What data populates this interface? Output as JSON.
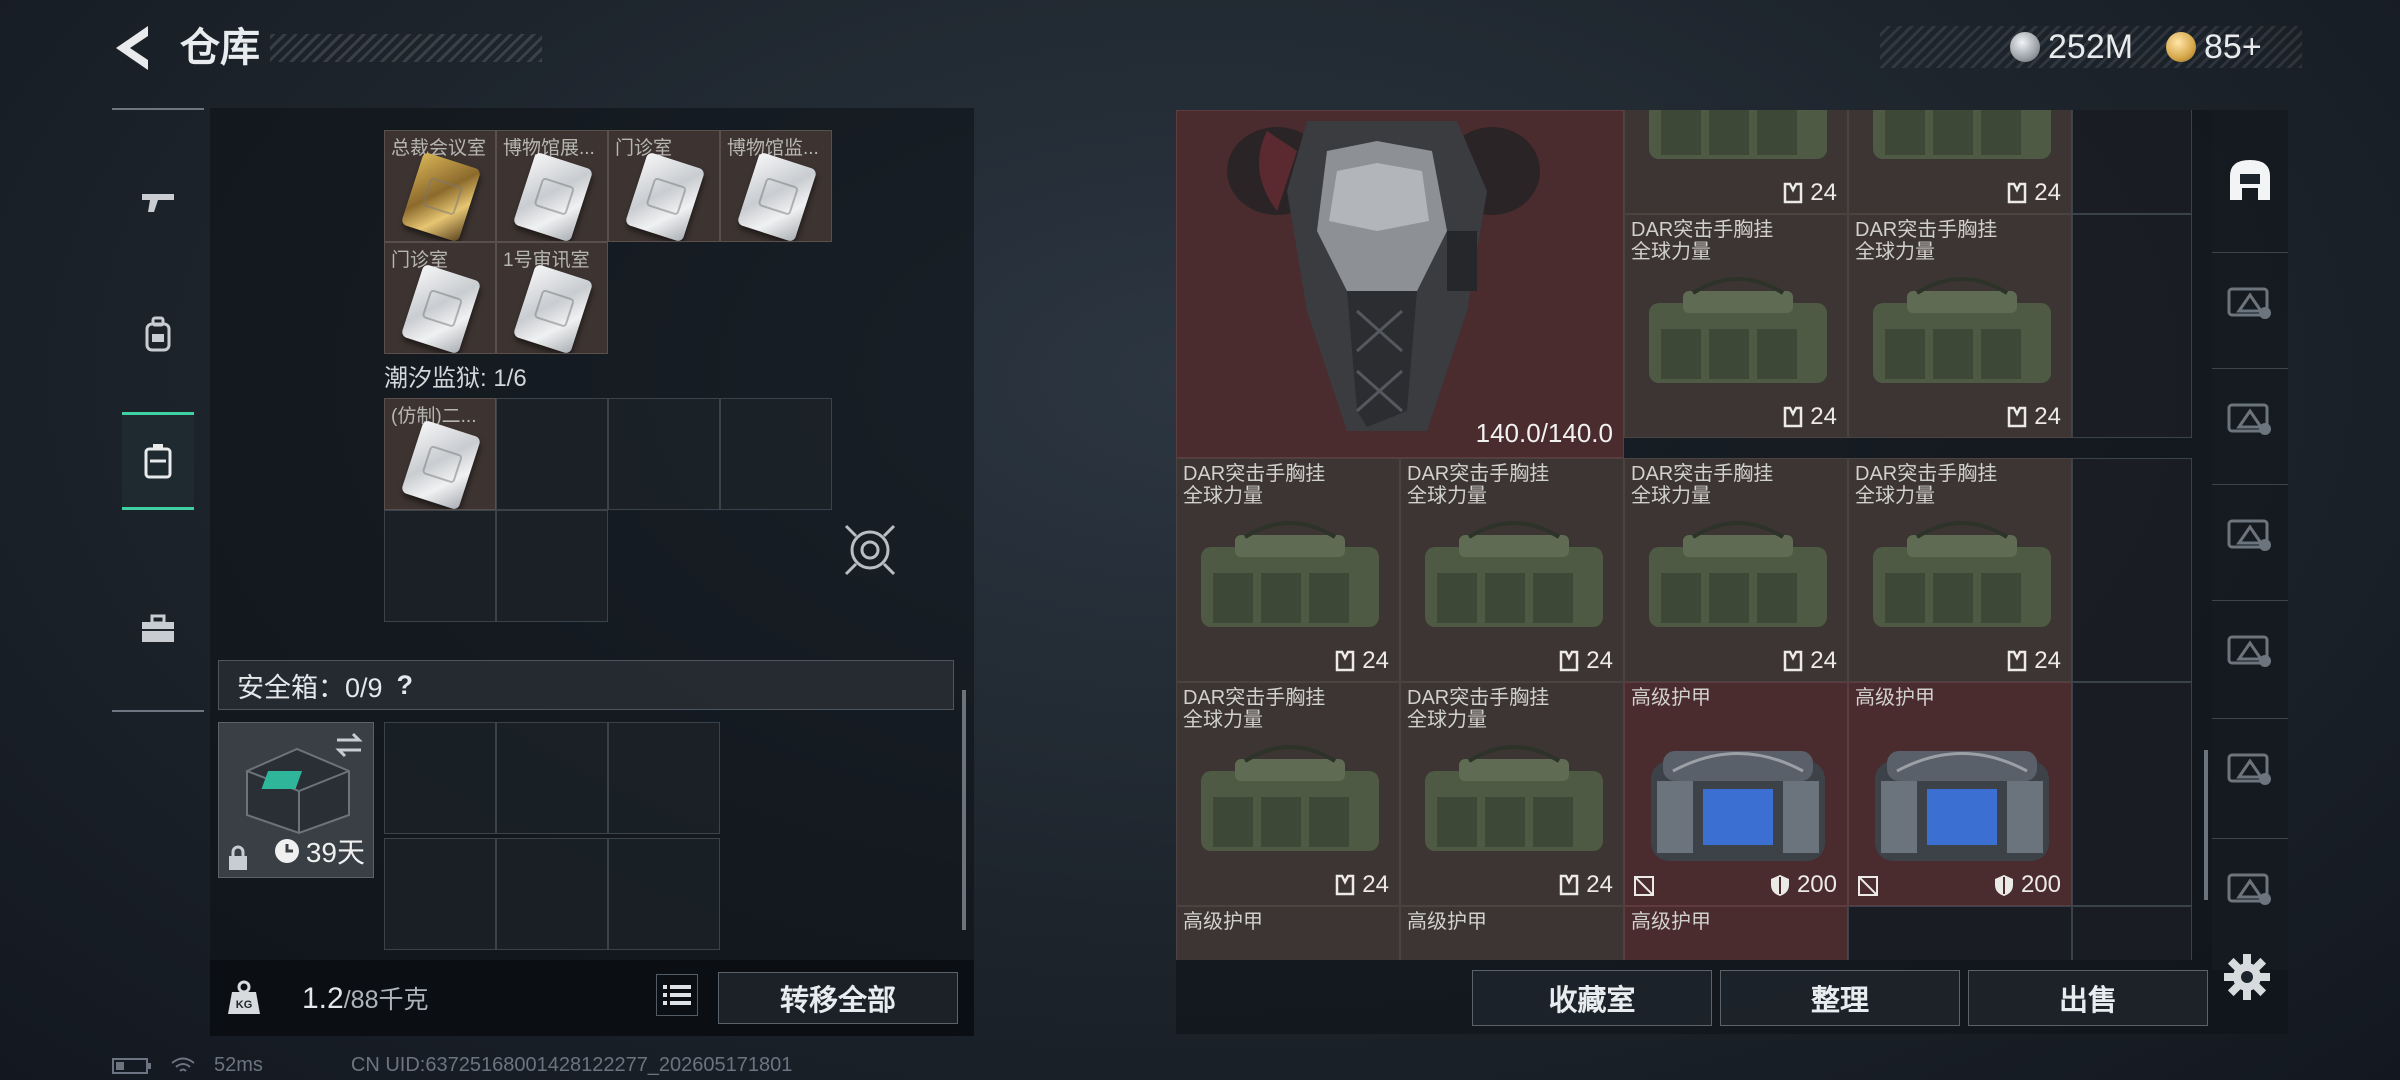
{
  "header": {
    "title": "仓库"
  },
  "currency": {
    "items": [
      {
        "icon": "silver-coin-icon",
        "value": "252M"
      },
      {
        "icon": "gold-coin-icon",
        "value": "85+"
      }
    ]
  },
  "left_nav": {
    "items": [
      "weapon-icon",
      "backpack-icon",
      "storage-icon",
      "toolbox-icon"
    ],
    "active": "storage-icon"
  },
  "keycards_top": [
    {
      "label": "总裁会议室",
      "tone": "gold"
    },
    {
      "label": "博物馆展...",
      "tone": "silver"
    },
    {
      "label": "门诊室",
      "tone": "silver"
    },
    {
      "label": "博物馆监...",
      "tone": "silver"
    },
    {
      "label": "门诊室",
      "tone": "silver"
    },
    {
      "label": "1号审讯室",
      "tone": "silver"
    }
  ],
  "prison": {
    "label": "潮汐监狱: 1/6",
    "cards": [
      {
        "label": "(仿制)二...",
        "tone": "silver"
      }
    ]
  },
  "safebox": {
    "label": "安全箱：0/9",
    "help": "?",
    "time": "39天"
  },
  "left_footer": {
    "weight_value": "1.2",
    "weight_capacity": "/88千克",
    "transfer_label": "转移全部"
  },
  "right_grid": {
    "armor": {
      "durability": "140.0/140.0"
    },
    "items": [
      {
        "name": "",
        "stat": "24",
        "kind": "rig"
      },
      {
        "name": "",
        "stat": "24",
        "kind": "rig"
      },
      {
        "name": "DAR突击手胸挂\n全球力量",
        "stat": "24",
        "kind": "rig"
      },
      {
        "name": "DAR突击手胸挂\n全球力量",
        "stat": "24",
        "kind": "rig"
      },
      {
        "name": "DAR突击手胸挂\n全球力量",
        "stat": "24",
        "kind": "rig"
      },
      {
        "name": "DAR突击手胸挂\n全球力量",
        "stat": "24",
        "kind": "rig"
      },
      {
        "name": "DAR突击手胸挂\n全球力量",
        "stat": "24",
        "kind": "rig"
      },
      {
        "name": "DAR突击手胸挂\n全球力量",
        "stat": "24",
        "kind": "rig"
      },
      {
        "name": "DAR突击手胸挂\n全球力量",
        "stat": "24",
        "kind": "rig"
      },
      {
        "name": "DAR突击手胸挂\n全球力量",
        "stat": "24",
        "kind": "rig"
      },
      {
        "name": "高级护甲",
        "stat": "200",
        "kind": "armor-bag"
      },
      {
        "name": "高级护甲",
        "stat": "200",
        "kind": "armor-bag"
      },
      {
        "name": "高级护甲",
        "stat": "",
        "kind": "partial"
      },
      {
        "name": "高级护甲",
        "stat": "",
        "kind": "partial"
      },
      {
        "name": "高级护甲",
        "stat": "",
        "kind": "partial"
      }
    ]
  },
  "right_nav": {
    "items": [
      "helmet-filter-icon",
      "level-gti-filter-icon",
      "level-iv-filter-icon",
      "level-iv-armor-filter-icon",
      "level-gti-armor-filter-icon",
      "level-iv-armor2-filter-icon",
      "level-v-filter-icon"
    ]
  },
  "right_footer": {
    "collection_label": "收藏室",
    "organize_label": "整理",
    "sell_label": "出售"
  },
  "status": {
    "ping": "52ms",
    "uid": "CN UID:637251680014281222​77_202605171801"
  },
  "colors": {
    "accent": "#3fd1a2",
    "red_cell": "#4a2b2e",
    "filled_cell": "#3c3533"
  }
}
